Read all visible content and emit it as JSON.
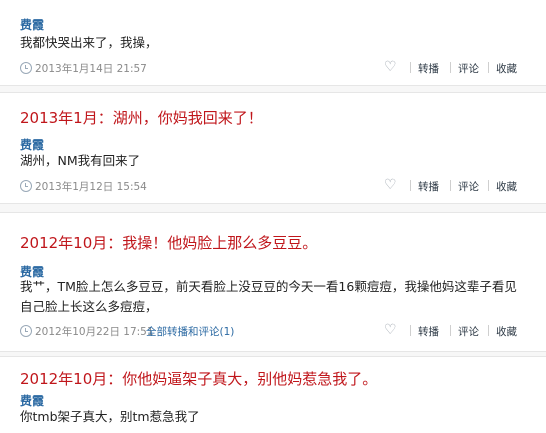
{
  "posts": [
    {
      "author": "费霞",
      "text": "我都快哭出来了，我操，",
      "date": "2013年1月14日 21:57",
      "actions": {
        "repost": "转播",
        "comment": "评论",
        "collect": "收藏"
      }
    },
    {
      "caption": "2013年1月：湖州，你妈我回来了！",
      "author": "费霞",
      "text": "湖州，NM我有回来了",
      "date": "2013年1月12日 15:54",
      "actions": {
        "repost": "转播",
        "comment": "评论",
        "collect": "收藏"
      }
    },
    {
      "caption": "2012年10月：我操！他妈脸上那么多豆豆。",
      "author": "费霞",
      "text": "我艹，TM脸上怎么多豆豆，前天看脸上没豆豆的今天一看16颗痘痘，我操他妈这辈子看见自己脸上长这么多痘痘，",
      "date": "2012年10月22日 17:51",
      "extra": "全部转播和评论(1)",
      "actions": {
        "repost": "转播",
        "comment": "评论",
        "collect": "收藏"
      }
    },
    {
      "caption": "2012年10月：你他妈逼架子真大，别他妈惹急我了。",
      "author": "费霞",
      "text": "你tmb架子真大，别tm惹急我了"
    }
  ],
  "icons": {
    "heart": "heart-icon",
    "clock": "clock-icon"
  },
  "colors": {
    "caption": "#c0161b",
    "author": "#2c6aa3",
    "meta": "#8a8a8a"
  }
}
